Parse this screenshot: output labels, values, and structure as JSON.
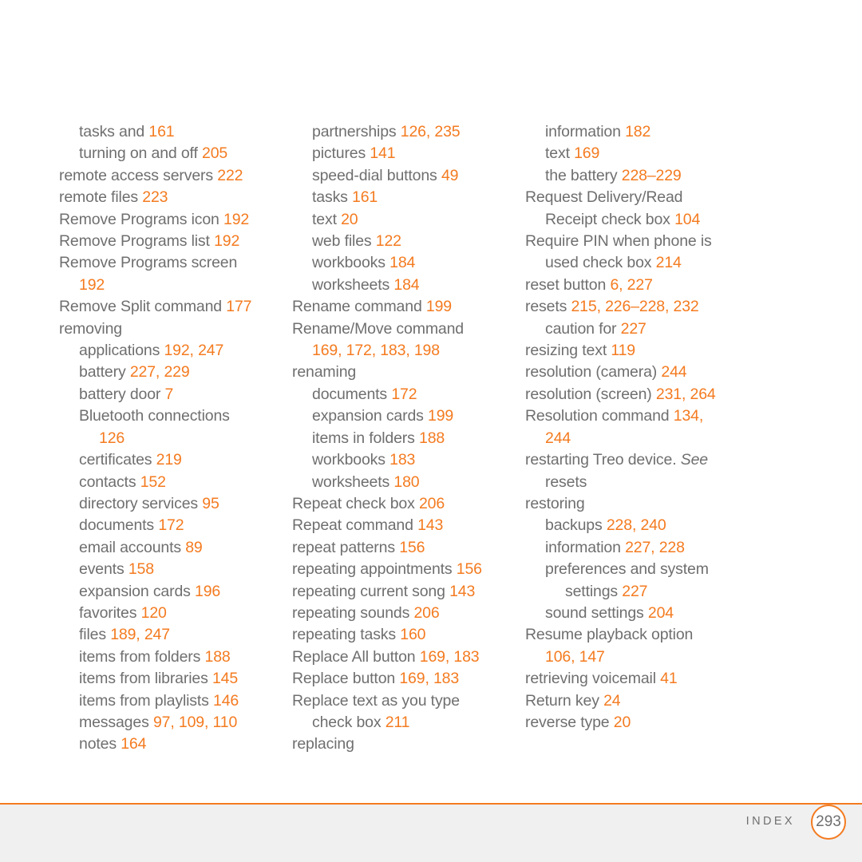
{
  "document": {
    "kind": "printed-index-page",
    "footer": {
      "section_label": "INDEX",
      "page_number": "293"
    },
    "colors": {
      "page_number_accent": "#f47b20",
      "body_text": "#6f6f6f",
      "footer_band": "#f0f0f0",
      "rule": "#f47b20"
    }
  },
  "columns": [
    {
      "id": "column-1",
      "entries": [
        {
          "level": 1,
          "term": "tasks and ",
          "pages": "161"
        },
        {
          "level": 1,
          "term": "turning on and off ",
          "pages": "205"
        },
        {
          "level": 0,
          "term": "remote access servers ",
          "pages": "222"
        },
        {
          "level": 0,
          "term": "remote files ",
          "pages": "223"
        },
        {
          "level": 0,
          "term": "Remove Programs icon ",
          "pages": "192"
        },
        {
          "level": 0,
          "term": "Remove Programs list ",
          "pages": "192"
        },
        {
          "level": 0,
          "term": "Remove Programs screen",
          "pages": ""
        },
        {
          "level": 1,
          "term": "",
          "pages": "192"
        },
        {
          "level": 0,
          "term": "Remove Split command ",
          "pages": "177"
        },
        {
          "level": 0,
          "term": "removing",
          "pages": ""
        },
        {
          "level": 1,
          "term": "applications ",
          "pages": "192, 247"
        },
        {
          "level": 1,
          "term": "battery ",
          "pages": "227, 229"
        },
        {
          "level": 1,
          "term": "battery door ",
          "pages": "7"
        },
        {
          "level": 1,
          "term": "Bluetooth connections",
          "pages": ""
        },
        {
          "level": 2,
          "term": "",
          "pages": "126"
        },
        {
          "level": 1,
          "term": "certificates ",
          "pages": "219"
        },
        {
          "level": 1,
          "term": "contacts ",
          "pages": "152"
        },
        {
          "level": 1,
          "term": "directory services ",
          "pages": "95"
        },
        {
          "level": 1,
          "term": "documents ",
          "pages": "172"
        },
        {
          "level": 1,
          "term": "email accounts ",
          "pages": "89"
        },
        {
          "level": 1,
          "term": "events ",
          "pages": "158"
        },
        {
          "level": 1,
          "term": "expansion cards ",
          "pages": "196"
        },
        {
          "level": 1,
          "term": "favorites ",
          "pages": "120"
        },
        {
          "level": 1,
          "term": "files ",
          "pages": "189, 247"
        },
        {
          "level": 1,
          "term": "items from folders ",
          "pages": "188"
        },
        {
          "level": 1,
          "term": "items from libraries ",
          "pages": "145"
        },
        {
          "level": 1,
          "term": "items from playlists ",
          "pages": "146"
        },
        {
          "level": 1,
          "term": "messages ",
          "pages": "97, 109, 110"
        },
        {
          "level": 1,
          "term": "notes ",
          "pages": "164"
        }
      ]
    },
    {
      "id": "column-2",
      "entries": [
        {
          "level": 1,
          "term": "partnerships ",
          "pages": "126, 235"
        },
        {
          "level": 1,
          "term": "pictures ",
          "pages": "141"
        },
        {
          "level": 1,
          "term": "speed-dial buttons ",
          "pages": "49"
        },
        {
          "level": 1,
          "term": "tasks ",
          "pages": "161"
        },
        {
          "level": 1,
          "term": "text ",
          "pages": "20"
        },
        {
          "level": 1,
          "term": "web files ",
          "pages": "122"
        },
        {
          "level": 1,
          "term": "workbooks ",
          "pages": "184"
        },
        {
          "level": 1,
          "term": "worksheets ",
          "pages": "184"
        },
        {
          "level": 0,
          "term": "Rename command ",
          "pages": "199"
        },
        {
          "level": 0,
          "term": "Rename/Move command",
          "pages": ""
        },
        {
          "level": 1,
          "term": "",
          "pages": "169, 172, 183, 198"
        },
        {
          "level": 0,
          "term": "renaming",
          "pages": ""
        },
        {
          "level": 1,
          "term": "documents ",
          "pages": "172"
        },
        {
          "level": 1,
          "term": "expansion cards ",
          "pages": "199"
        },
        {
          "level": 1,
          "term": "items in folders ",
          "pages": "188"
        },
        {
          "level": 1,
          "term": "workbooks ",
          "pages": "183"
        },
        {
          "level": 1,
          "term": "worksheets ",
          "pages": "180"
        },
        {
          "level": 0,
          "term": "Repeat check box ",
          "pages": "206"
        },
        {
          "level": 0,
          "term": "Repeat command ",
          "pages": "143"
        },
        {
          "level": 0,
          "term": "repeat patterns ",
          "pages": "156"
        },
        {
          "level": 0,
          "term": "repeating appointments ",
          "pages": "156"
        },
        {
          "level": 0,
          "term": "repeating current song ",
          "pages": "143"
        },
        {
          "level": 0,
          "term": "repeating sounds ",
          "pages": "206"
        },
        {
          "level": 0,
          "term": "repeating tasks ",
          "pages": "160"
        },
        {
          "level": 0,
          "term": "Replace All button ",
          "pages": "169, 183"
        },
        {
          "level": 0,
          "term": "Replace button ",
          "pages": "169, 183"
        },
        {
          "level": 0,
          "term": "Replace text as you type",
          "pages": ""
        },
        {
          "level": 1,
          "term": "check box ",
          "pages": "211"
        },
        {
          "level": 0,
          "term": "replacing",
          "pages": ""
        }
      ]
    },
    {
      "id": "column-3",
      "entries": [
        {
          "level": 1,
          "term": "information ",
          "pages": "182"
        },
        {
          "level": 1,
          "term": "text ",
          "pages": "169"
        },
        {
          "level": 1,
          "term": "the battery ",
          "pages": "228–229"
        },
        {
          "level": 0,
          "term": "Request Delivery/Read",
          "pages": ""
        },
        {
          "level": 1,
          "term": "Receipt check box ",
          "pages": "104"
        },
        {
          "level": 0,
          "term": "Require PIN when phone is",
          "pages": ""
        },
        {
          "level": 1,
          "term": "used check box ",
          "pages": "214"
        },
        {
          "level": 0,
          "term": "reset button ",
          "pages": "6, 227"
        },
        {
          "level": 0,
          "term": "resets ",
          "pages": "215, 226–228, 232"
        },
        {
          "level": 1,
          "term": "caution for ",
          "pages": "227"
        },
        {
          "level": 0,
          "term": "resizing text ",
          "pages": "119"
        },
        {
          "level": 0,
          "term": "resolution (camera) ",
          "pages": "244"
        },
        {
          "level": 0,
          "term": "resolution (screen) ",
          "pages": "231, 264"
        },
        {
          "level": 0,
          "term": "Resolution command ",
          "pages": "134,"
        },
        {
          "level": 1,
          "term": "",
          "pages": "244"
        },
        {
          "level": 0,
          "term": "restarting Treo device. ",
          "italic": "See",
          "pages": ""
        },
        {
          "level": 1,
          "term": "resets",
          "pages": ""
        },
        {
          "level": 0,
          "term": "restoring",
          "pages": ""
        },
        {
          "level": 1,
          "term": "backups ",
          "pages": "228, 240"
        },
        {
          "level": 1,
          "term": "information ",
          "pages": "227, 228"
        },
        {
          "level": 1,
          "term": "preferences and system",
          "pages": ""
        },
        {
          "level": 2,
          "term": "settings ",
          "pages": "227"
        },
        {
          "level": 1,
          "term": "sound settings ",
          "pages": "204"
        },
        {
          "level": 0,
          "term": "Resume playback option",
          "pages": ""
        },
        {
          "level": 1,
          "term": "",
          "pages": "106, 147"
        },
        {
          "level": 0,
          "term": "retrieving voicemail ",
          "pages": "41"
        },
        {
          "level": 0,
          "term": "Return key ",
          "pages": "24"
        },
        {
          "level": 0,
          "term": "reverse type ",
          "pages": "20"
        }
      ]
    }
  ]
}
